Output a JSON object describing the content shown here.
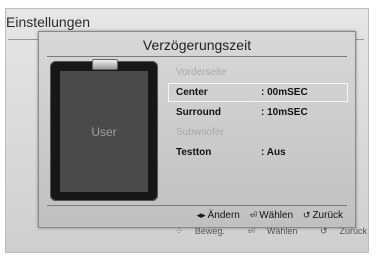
{
  "background": {
    "title": "Einstellungen",
    "footer": [
      {
        "icon": "⁘",
        "label": "Beweg."
      },
      {
        "icon": "⏎",
        "label": "Wählen"
      },
      {
        "icon": "↺",
        "label": "Zurück"
      }
    ]
  },
  "dialog": {
    "title": "Verzögerungszeit",
    "image_label": "User",
    "rows": [
      {
        "label": "Vorderseite",
        "value": "",
        "state": "disabled"
      },
      {
        "label": "Center",
        "value": ":   00mSEC",
        "state": "selected"
      },
      {
        "label": "Surround",
        "value": ":   10mSEC",
        "state": "normal"
      },
      {
        "label": "Subwoofer",
        "value": "",
        "state": "disabled"
      },
      {
        "label": "Testton",
        "value": ":   Aus",
        "state": "normal"
      }
    ],
    "footer": [
      {
        "icon": "◂▸",
        "label": "Ändern"
      },
      {
        "icon": "⏎",
        "label": "Wählen"
      },
      {
        "icon": "↺",
        "label": "Zurück"
      }
    ]
  }
}
